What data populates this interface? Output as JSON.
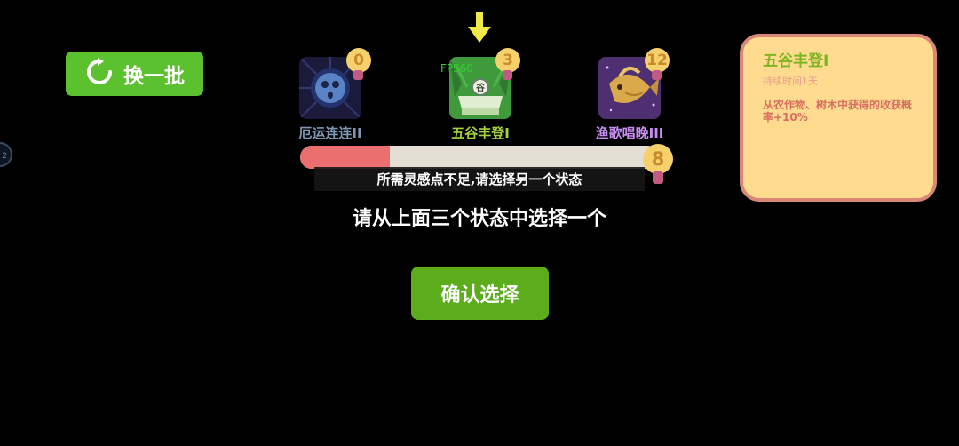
{
  "refresh_button": {
    "label": "换一批",
    "icon": "refresh-icon"
  },
  "side_indicator": {
    "text": "2"
  },
  "selector_arrow": {
    "icon": "down-arrow-icon",
    "color": "#f1e84a"
  },
  "fps_counter": "FPS60",
  "status_options": [
    {
      "name": "厄运连连II",
      "count": "0",
      "name_color": "#7e98b4",
      "icon": "dark-face-orb-icon",
      "selected": false
    },
    {
      "name": "五谷丰登I",
      "count": "3",
      "name_color": "#a6d33c",
      "icon": "grain-sack-icon",
      "selected": true
    },
    {
      "name": "渔歌唱晚III",
      "count": "12",
      "name_color": "#c78ef2",
      "icon": "golden-fish-icon",
      "selected": false
    }
  ],
  "inspiration_bar": {
    "value": "8",
    "fill_fraction": 0.25
  },
  "toast_message": "所需灵感点不足,请选择另一个状态",
  "prompt_text": "请从上面三个状态中选择一个",
  "confirm_button": {
    "label": "确认选择"
  },
  "detail_panel": {
    "title": "五谷丰登I",
    "duration": "持续时间1天",
    "description": "从农作物、树木中获得的收获概率+10%"
  },
  "colors": {
    "accent_green": "#5bc12e",
    "badge_gold": "#f6d16b",
    "panel_bg": "#ffdb8f",
    "bar_fill": "#ec6f70"
  }
}
